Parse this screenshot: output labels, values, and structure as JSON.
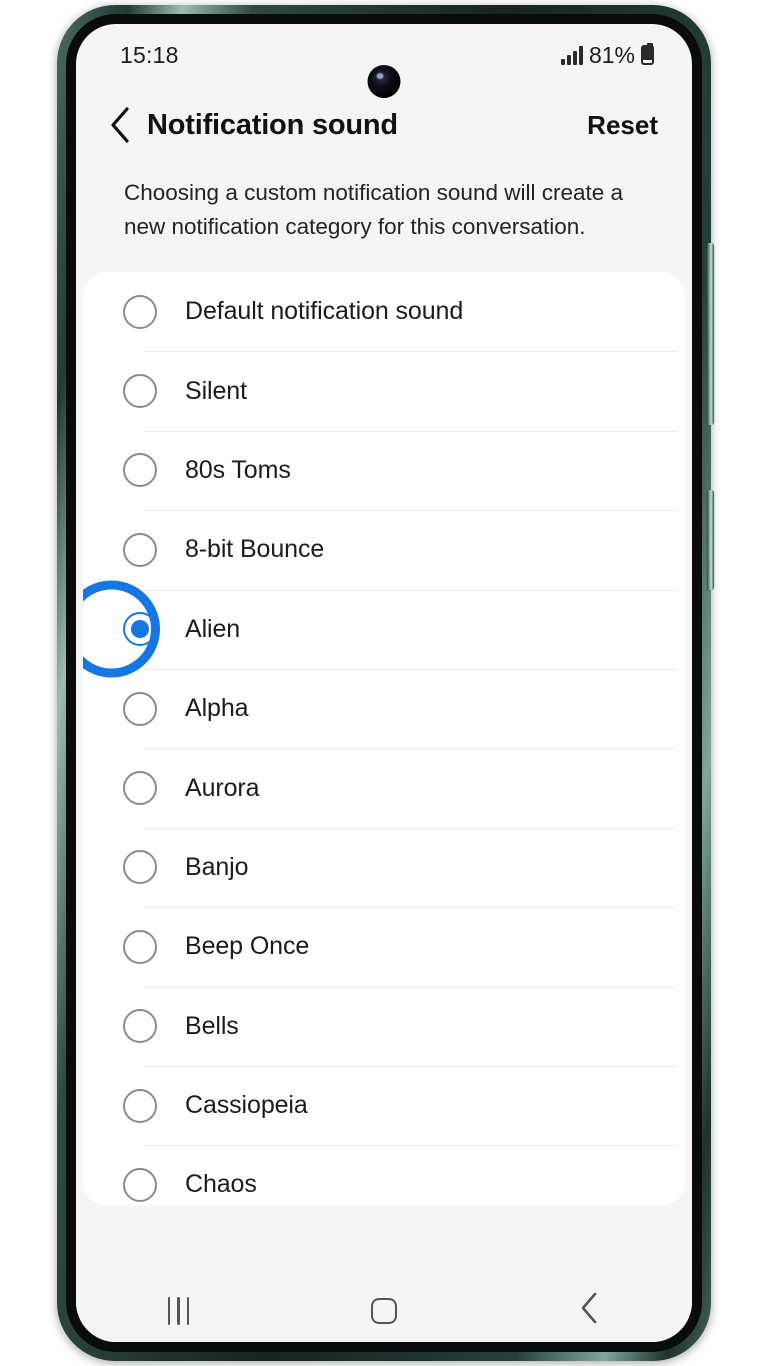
{
  "status_bar": {
    "time": "15:18",
    "battery_percent": "81%",
    "signal_icon": "signal-bars-icon",
    "battery_icon": "battery-icon"
  },
  "app_bar": {
    "back_icon": "back-arrow-icon",
    "title": "Notification sound",
    "reset_label": "Reset"
  },
  "description": "Choosing a custom notification sound will create a new notification category for this conversation.",
  "sound_list": {
    "selected": "Alien",
    "items": [
      {
        "label": "Default notification sound",
        "selected": false
      },
      {
        "label": "Silent",
        "selected": false
      },
      {
        "label": "80s Toms",
        "selected": false
      },
      {
        "label": "8-bit Bounce",
        "selected": false
      },
      {
        "label": "Alien",
        "selected": true
      },
      {
        "label": "Alpha",
        "selected": false
      },
      {
        "label": "Aurora",
        "selected": false
      },
      {
        "label": "Banjo",
        "selected": false
      },
      {
        "label": "Beep Once",
        "selected": false
      },
      {
        "label": "Bells",
        "selected": false
      },
      {
        "label": "Cassiopeia",
        "selected": false
      },
      {
        "label": "Chaos",
        "selected": false
      }
    ]
  },
  "navigation_bar": {
    "recents_icon": "recents-icon",
    "home_icon": "home-icon",
    "back_icon": "back-chevron-icon"
  },
  "colors": {
    "accent_blue": "#1577e3",
    "screen_background": "#f5f5f5",
    "card_background": "#ffffff",
    "text_primary": "#1b1b1b",
    "divider": "#e8e8e8",
    "frame_green": "#2e4a42"
  }
}
